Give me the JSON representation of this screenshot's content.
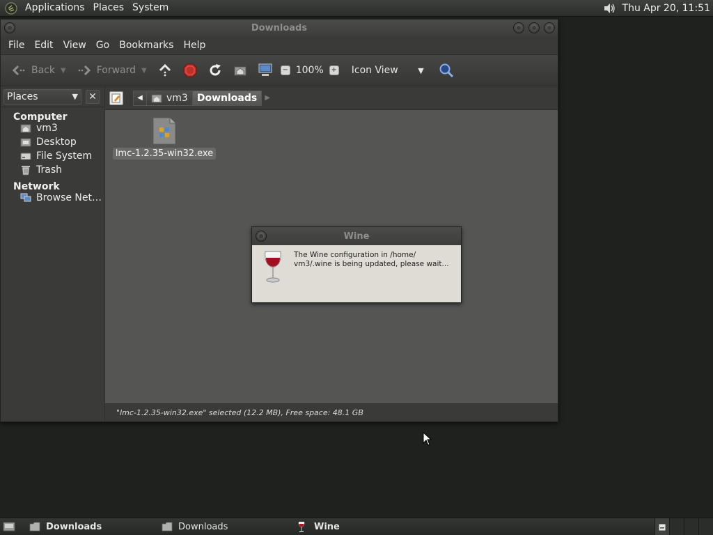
{
  "top_panel": {
    "menus": [
      "Applications",
      "Places",
      "System"
    ],
    "clock": "Thu Apr 20, 11:51",
    "icons": {
      "logo": "gnome-foot-icon",
      "volume": "volume-icon"
    }
  },
  "window": {
    "title": "Downloads",
    "menubar": [
      "File",
      "Edit",
      "View",
      "Go",
      "Bookmarks",
      "Help"
    ],
    "toolbar": {
      "back_label": "Back",
      "forward_label": "Forward",
      "zoom_value": "100%",
      "view_mode": "Icon View"
    },
    "sidebar": {
      "selector_label": "Places",
      "sections": [
        {
          "heading": "Computer",
          "items": [
            "vm3",
            "Desktop",
            "File System",
            "Trash"
          ]
        },
        {
          "heading": "Network",
          "items": [
            "Browse Net…"
          ]
        }
      ]
    },
    "pathbar": {
      "crumbs": [
        "vm3",
        "Downloads"
      ]
    },
    "files": [
      {
        "name": "lmc-1.2.35-win32.exe",
        "selected": true
      }
    ],
    "status": "\"lmc-1.2.35-win32.exe\" selected (12.2 MB), Free space: 48.1 GB"
  },
  "wine_dialog": {
    "title": "Wine",
    "message_line1": "The Wine configuration in /home/",
    "message_line2": "vm3/.wine is being updated, please wait..."
  },
  "bottom_panel": {
    "tasks": [
      {
        "label": "Downloads",
        "active": true
      },
      {
        "label": "Downloads",
        "active": false
      },
      {
        "label": "Wine",
        "active": true
      }
    ]
  },
  "colors": {
    "desktop_bg": "#1f211e",
    "panel_bg": "#343633",
    "window_bg": "#3a3b39",
    "content_bg": "#555654",
    "dialog_bg": "#dfdcd6",
    "stop_red": "#c0302a"
  }
}
